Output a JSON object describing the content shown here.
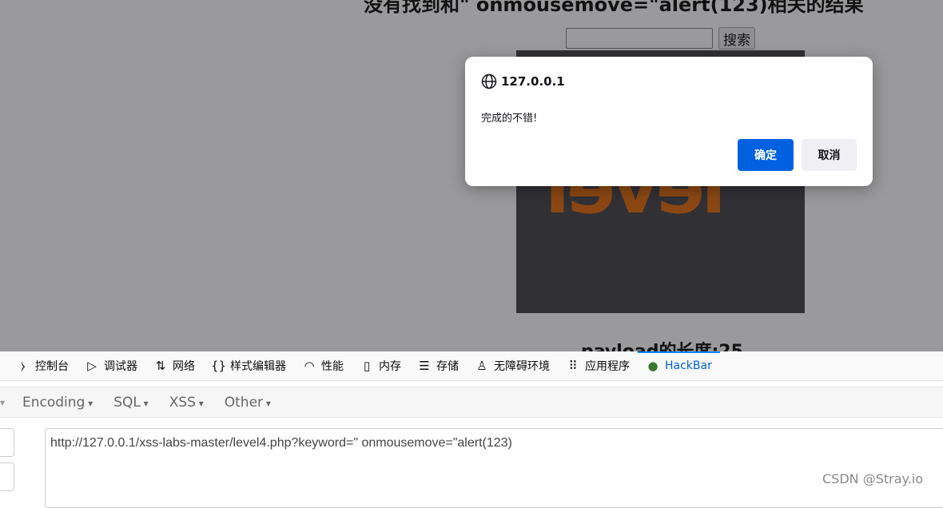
{
  "page": {
    "heading": "没有找到和\" onmousemove=\"alert(123)相关的结果",
    "search_button": "搜索",
    "search_value": "",
    "level_logo": "level",
    "payload_length": "payload的长度:25"
  },
  "dialog": {
    "origin": "127.0.0.1",
    "message": "完成的不错!",
    "ok": "确定",
    "cancel": "取消"
  },
  "devtools": {
    "tabs": [
      {
        "icon": "console-icon",
        "glyph": "⧽",
        "label": "控制台"
      },
      {
        "icon": "debugger-icon",
        "glyph": "▷",
        "label": "调试器"
      },
      {
        "icon": "network-icon",
        "glyph": "⇅",
        "label": "网络"
      },
      {
        "icon": "style-editor-icon",
        "glyph": "{}",
        "label": "样式编辑器"
      },
      {
        "icon": "performance-icon",
        "glyph": "◠",
        "label": "性能"
      },
      {
        "icon": "memory-icon",
        "glyph": "▯",
        "label": "内存"
      },
      {
        "icon": "storage-icon",
        "glyph": "☰",
        "label": "存储"
      },
      {
        "icon": "accessibility-icon",
        "glyph": "♙",
        "label": "无障碍环境"
      },
      {
        "icon": "apps-icon",
        "glyph": "⠿",
        "label": "应用程序"
      },
      {
        "icon": "hackbar-icon",
        "glyph": "●",
        "label": "HackBar",
        "active": true
      }
    ]
  },
  "hackbar": {
    "menus": [
      "Encoding",
      "SQL",
      "XSS",
      "Other"
    ],
    "url": "http://127.0.0.1/xss-labs-master/level4.php?keyword=\" onmousemove=\"alert(123)"
  },
  "watermark": "CSDN @Stray.io",
  "colors": {
    "accent": "#0061e0",
    "overlay": "#9a999b",
    "logo": "#8b4713"
  }
}
